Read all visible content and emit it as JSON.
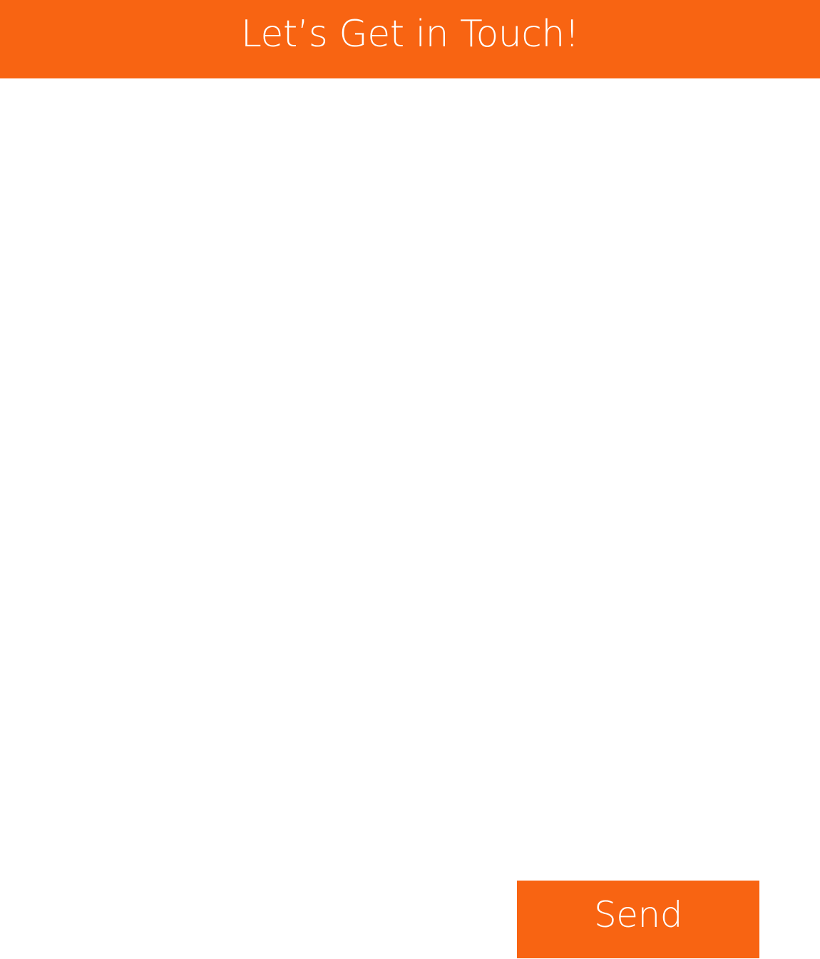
{
  "header": {
    "title": "Let’s Get in Touch!"
  },
  "form": {
    "send_label": "Send"
  },
  "colors": {
    "accent": "#f86412",
    "background": "#ffffff",
    "text_on_accent": "#ffffff"
  }
}
